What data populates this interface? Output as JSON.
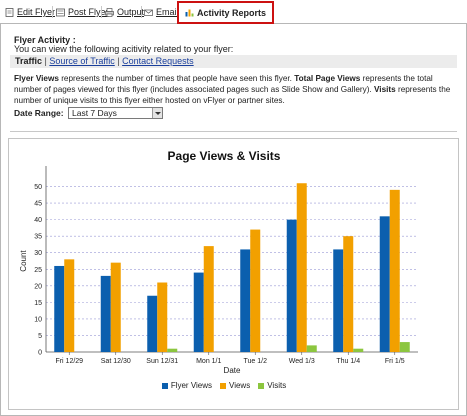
{
  "tabs": [
    {
      "label": "Edit Flyer",
      "icon": "document-icon"
    },
    {
      "label": "Post Flyer",
      "icon": "post-icon"
    },
    {
      "label": "Output",
      "icon": "printer-icon"
    },
    {
      "label": "Email",
      "icon": "envelope-icon"
    },
    {
      "label": "Activity Reports",
      "icon": "bar-chart-icon",
      "active": true
    }
  ],
  "section": {
    "title": "Flyer Activity :",
    "intro": "You can view the following acitivity related to your flyer:"
  },
  "subnav": {
    "current": "Traffic",
    "links": [
      "Source of Traffic",
      "Contact Requests"
    ]
  },
  "description": {
    "flyer_views_term": "Flyer Views",
    "flyer_views_text": " represents the number of times that people have seen this flyer. ",
    "total_page_views_term": "Total Page Views",
    "total_page_views_text": " represents the total number of pages viewed for this flyer (includes associated pages such as Slide Show and Gallery). ",
    "visits_term": "Visits",
    "visits_text": " represents the number of unique visits to this flyer either hosted on vFlyer or partner sites."
  },
  "date_range": {
    "label": "Date Range:",
    "selected": "Last 7 Days"
  },
  "colors": {
    "accent_red": "#cc1111",
    "link": "#1a3f9c"
  },
  "chart_data": {
    "type": "bar",
    "title": "Page Views & Visits",
    "xlabel": "Date",
    "ylabel": "Count",
    "ylim": [
      0,
      55
    ],
    "yticks": [
      0,
      5,
      10,
      15,
      20,
      25,
      30,
      35,
      40,
      45,
      50
    ],
    "grid": true,
    "legend_position": "bottom",
    "categories": [
      "Fri 12/29",
      "Sat 12/30",
      "Sun 12/31",
      "Mon 1/1",
      "Tue 1/2",
      "Wed 1/3",
      "Thu 1/4",
      "Fri 1/5"
    ],
    "series": [
      {
        "name": "Flyer Views",
        "color": "#0b5fae",
        "values": [
          26,
          23,
          17,
          24,
          31,
          40,
          31,
          41
        ]
      },
      {
        "name": "Views",
        "color": "#f2a000",
        "values": [
          28,
          27,
          21,
          32,
          37,
          51,
          35,
          49
        ]
      },
      {
        "name": "Visits",
        "color": "#8cc63f",
        "values": [
          0,
          0,
          1,
          0,
          0,
          2,
          1,
          3
        ]
      }
    ]
  }
}
